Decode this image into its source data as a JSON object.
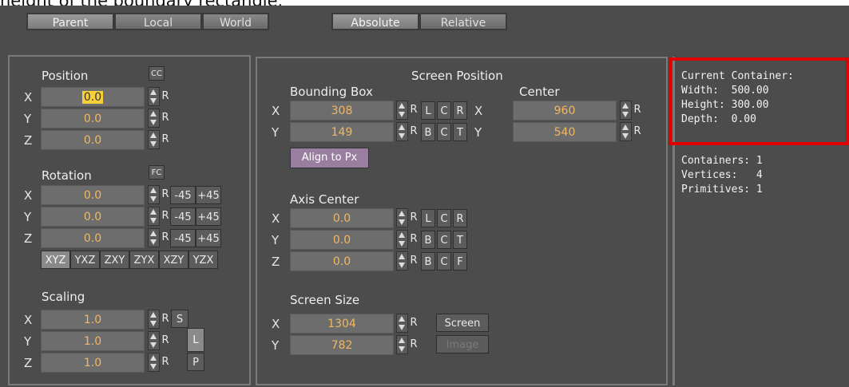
{
  "caption": "height of the boundary rectangle.",
  "tabs": {
    "parent": "Parent",
    "local": "Local",
    "world": "World",
    "absolute": "Absolute",
    "relative": "Relative"
  },
  "left": {
    "position": {
      "title": "Position",
      "cc": "CC",
      "x": "0.0",
      "y": "0.0",
      "z": "0.0"
    },
    "rotation": {
      "title": "Rotation",
      "fc": "FC",
      "x": "0.0",
      "y": "0.0",
      "z": "0.0",
      "m45": "-45",
      "p45": "+45",
      "orders": [
        "XYZ",
        "YXZ",
        "ZXY",
        "ZYX",
        "XZY",
        "YZX"
      ]
    },
    "scaling": {
      "title": "Scaling",
      "x": "1.0",
      "y": "1.0",
      "z": "1.0",
      "s": "S",
      "l": "L",
      "p": "P"
    },
    "axes": {
      "x": "X",
      "y": "Y",
      "z": "Z"
    },
    "r": "R"
  },
  "mid": {
    "title": "Screen Position",
    "bounding_box": {
      "title": "Bounding Box",
      "x": "308",
      "y": "149",
      "l": "L",
      "c": "C",
      "r": "R",
      "b": "B",
      "t": "T"
    },
    "center": {
      "title": "Center",
      "x": "960",
      "y": "540"
    },
    "align": "Align to Px",
    "axis_center": {
      "title": "Axis Center",
      "x": "0.0",
      "y": "0.0",
      "z": "0.0",
      "f": "F"
    },
    "screen_size": {
      "title": "Screen Size",
      "x": "1304",
      "y": "782",
      "screen": "Screen",
      "image": "Image"
    }
  },
  "info": {
    "current": "Current Container:",
    "width": "Width:  500.00",
    "height": "Height: 300.00",
    "depth": "Depth:  0.00",
    "containers": "Containers: 1",
    "vertices": "Vertices:   4",
    "primitives": "Primitives: 1"
  }
}
